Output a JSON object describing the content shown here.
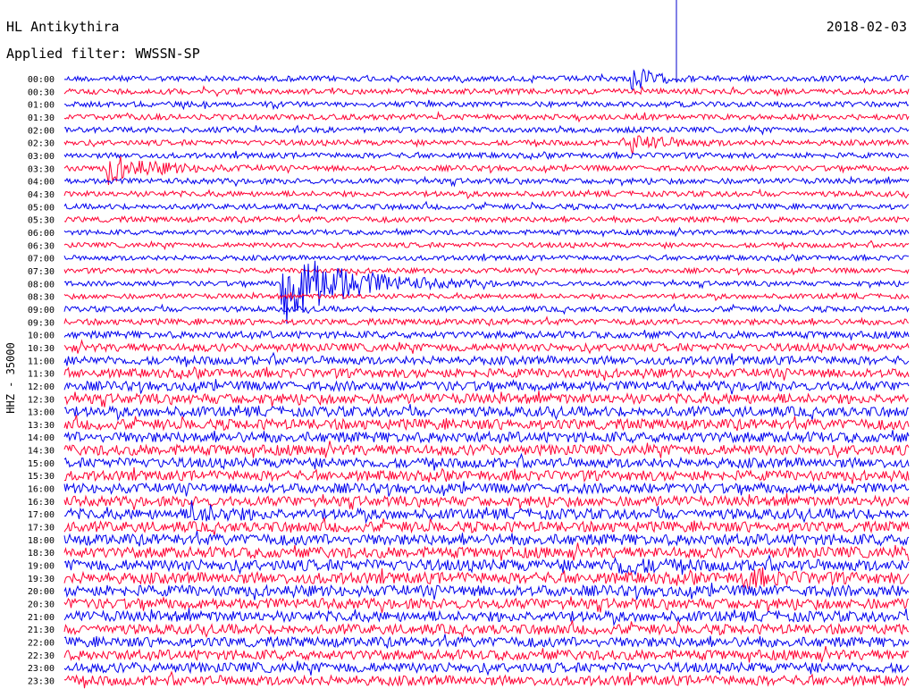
{
  "header": {
    "station": "HL Antikythira",
    "date": "2018-02-03",
    "filter": "Applied filter: WWSSN-SP"
  },
  "chart_data": {
    "type": "helicorder",
    "channel_label": "HHZ - 35000",
    "row_labels": [
      "00:00",
      "00:30",
      "01:00",
      "01:30",
      "02:00",
      "02:30",
      "03:00",
      "03:30",
      "04:00",
      "04:30",
      "05:00",
      "05:30",
      "06:00",
      "06:30",
      "07:00",
      "07:30",
      "08:00",
      "08:30",
      "09:00",
      "09:30",
      "10:00",
      "10:30",
      "11:00",
      "11:30",
      "12:00",
      "12:30",
      "13:00",
      "13:30",
      "14:00",
      "14:30",
      "15:00",
      "15:30",
      "16:00",
      "16:30",
      "17:00",
      "17:30",
      "18:00",
      "18:30",
      "19:00",
      "19:30",
      "20:00",
      "20:30",
      "21:00",
      "21:30",
      "22:00",
      "22:30",
      "23:00",
      "23:30"
    ],
    "series_colors": [
      "#0000ee",
      "#ff0033"
    ],
    "row_duration_minutes": 30,
    "noise_level": [
      0.55,
      0.55,
      0.55,
      0.55,
      0.55,
      0.55,
      0.55,
      0.55,
      0.55,
      0.55,
      0.55,
      0.55,
      0.5,
      0.5,
      0.5,
      0.5,
      0.5,
      0.5,
      0.55,
      0.6,
      0.7,
      0.8,
      0.85,
      0.9,
      0.95,
      1.0,
      1.0,
      1.05,
      1.05,
      1.05,
      1.0,
      1.0,
      1.0,
      1.0,
      1.05,
      1.05,
      1.1,
      1.1,
      1.15,
      1.15,
      1.1,
      1.05,
      1.05,
      1.0,
      1.0,
      1.0,
      1.0,
      1.0
    ],
    "events": [
      {
        "row": 0,
        "minute": 20.1,
        "amplitude": 3.0,
        "duration_minutes": 0.6
      },
      {
        "row": 5,
        "minute": 20.1,
        "amplitude": 2.0,
        "duration_minutes": 1.0
      },
      {
        "row": 7,
        "minute": 1.5,
        "amplitude": 2.5,
        "duration_minutes": 1.5
      },
      {
        "row": 16,
        "minute": 7.7,
        "amplitude": 8.0,
        "duration_minutes": 2.0
      },
      {
        "row": 34,
        "minute": 4.5,
        "amplitude": 1.8,
        "duration_minutes": 1.0
      },
      {
        "row": 38,
        "minute": 19.5,
        "amplitude": 1.5,
        "duration_minutes": 1.0
      },
      {
        "row": 39,
        "minute": 24.0,
        "amplitude": 1.5,
        "duration_minutes": 1.0
      }
    ]
  }
}
